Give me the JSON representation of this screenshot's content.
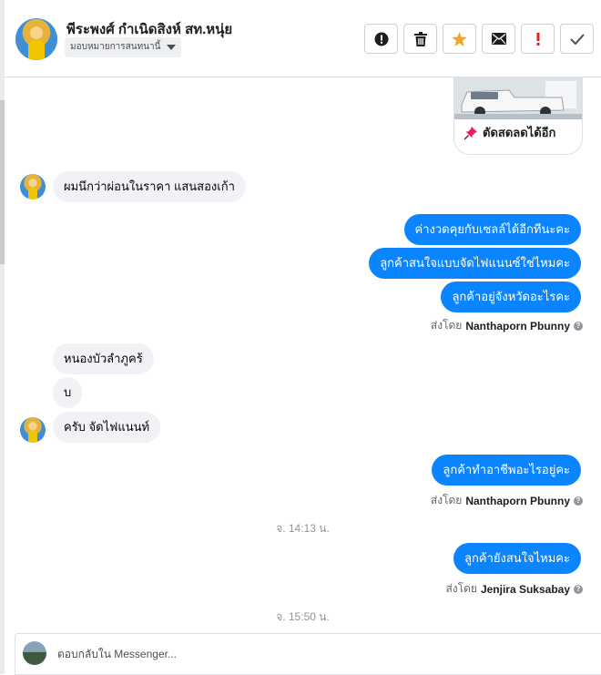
{
  "header": {
    "contact_name": "พีระพงศ์ กำเนิดสิงห์ สท.หนุ่ย",
    "assign_label": "มอบหมายการสนทนานี้",
    "actions": [
      {
        "name": "report-button",
        "icon": "exclamation-circle-icon"
      },
      {
        "name": "delete-button",
        "icon": "trash-icon"
      },
      {
        "name": "star-button",
        "icon": "star-icon"
      },
      {
        "name": "mark-unread-button",
        "icon": "envelope-icon"
      },
      {
        "name": "mark-important-button",
        "icon": "exclamation-icon"
      },
      {
        "name": "mark-done-button",
        "icon": "checkmark-icon"
      }
    ]
  },
  "colors": {
    "outgoing_bubble": "#0b84ff",
    "incoming_bubble": "#f0f2f5",
    "star": "#f5a623",
    "important": "#e02020"
  },
  "post_card": {
    "title": "ตัดสดลดได้อีก",
    "icon": "pushpin-icon"
  },
  "messages": [
    {
      "dir": "in",
      "text": "ผมนึกว่าผ่อนในราคา แสนสองเก้า"
    },
    {
      "dir": "out",
      "text": "ค่างวดคุยกับเซลล์ได้อีกทีนะคะ"
    },
    {
      "dir": "out",
      "text": "ลูกค้าสนใจแบบจัดไฟแนนซ์ใช่ไหมคะ"
    },
    {
      "dir": "out",
      "text": "ลูกค้าอยู่จังหวัดอะไรคะ"
    },
    {
      "dir": "in",
      "text": "หนองบัวลำภูคร้"
    },
    {
      "dir": "in",
      "text": "บ"
    },
    {
      "dir": "in",
      "text": "ครับ จัดไฟแนนท์"
    },
    {
      "dir": "out",
      "text": "ลูกค้าทำอาชีพอะไรอยู่คะ"
    },
    {
      "dir": "out",
      "text": "ลูกค้ายังสนใจไหมคะ"
    }
  ],
  "sent_by": [
    {
      "prefix": "ส่งโดย",
      "name": "Nanthaporn Pbunny"
    },
    {
      "prefix": "ส่งโดย",
      "name": "Nanthaporn Pbunny"
    },
    {
      "prefix": "ส่งโดย",
      "name": "Jenjira Suksabay"
    }
  ],
  "timestamps": [
    "จ. 14:13 น.",
    "จ. 15:50 น."
  ],
  "composer": {
    "placeholder": "ตอบกลับใน Messenger..."
  }
}
